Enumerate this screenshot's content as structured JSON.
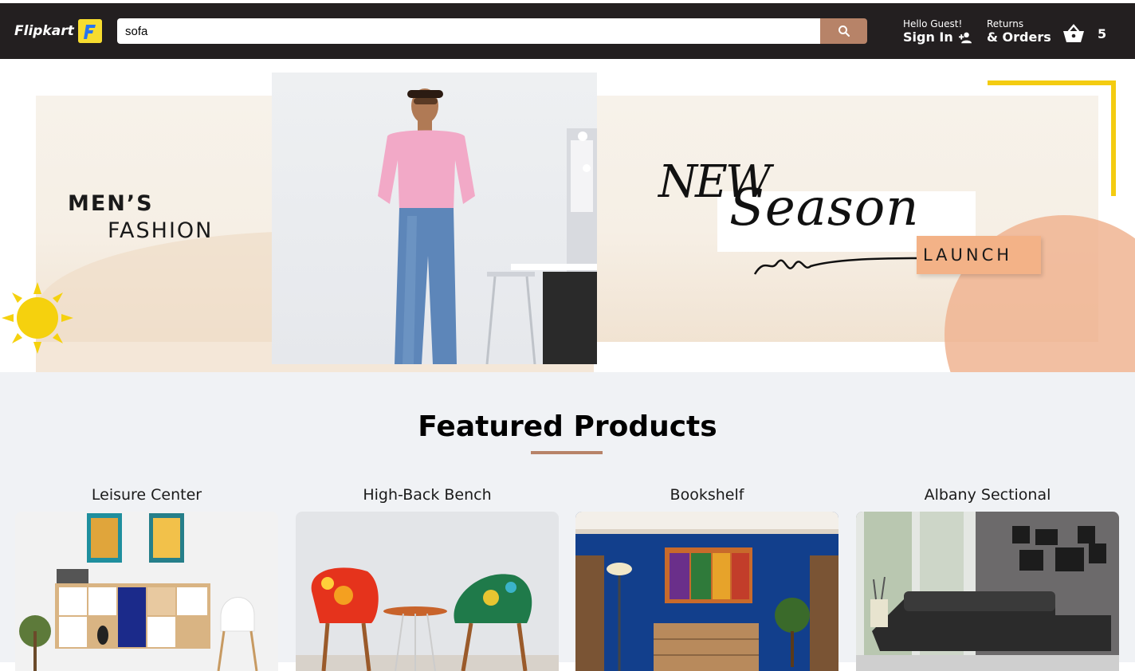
{
  "header": {
    "brand": "Flipkart",
    "search_value": "sofa",
    "greeting": "Hello Guest!",
    "signin_label": "Sign In",
    "returns_label": "Returns",
    "orders_label": "& Orders",
    "cart_count": "5",
    "icons": {
      "search": "search-icon",
      "signin": "person-add-icon",
      "cart": "basket-icon",
      "logo": "flipkart-f-icon"
    }
  },
  "banner": {
    "mens_line1": "MEN’S",
    "mens_line2": "FASHION",
    "new_text": "NEW",
    "season_text": "Season",
    "launch_text": "LAUNCH"
  },
  "featured": {
    "title": "Featured Products",
    "products": [
      {
        "name": "Leisure Center"
      },
      {
        "name": "High-Back Bench"
      },
      {
        "name": "Bookshelf"
      },
      {
        "name": "Albany Sectional"
      }
    ]
  },
  "colors": {
    "navbar": "#231f20",
    "accent": "#b78368",
    "yellow": "#f4cc11",
    "section_bg": "#f0f2f5"
  }
}
